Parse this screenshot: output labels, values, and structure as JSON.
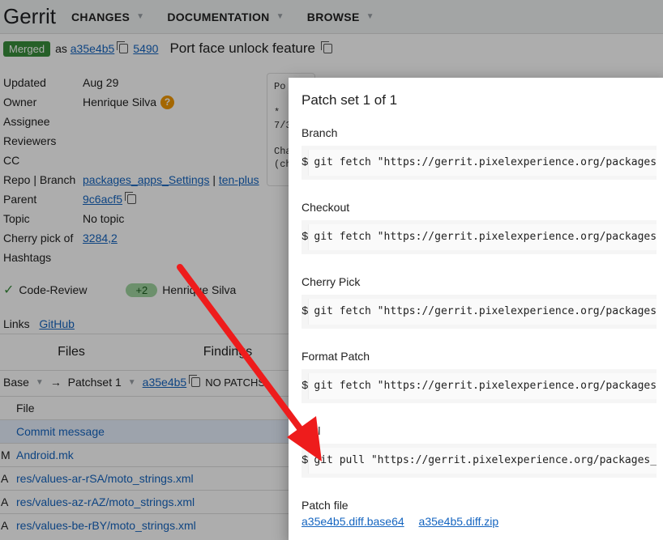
{
  "topbar": {
    "logo": "Gerrit",
    "nav": [
      "CHANGES",
      "DOCUMENTATION",
      "BROWSE"
    ]
  },
  "change": {
    "status": "Merged",
    "as_text": "as",
    "commit": "a35e4b5",
    "number": "5490",
    "subject": "Port face unlock feature"
  },
  "meta": {
    "updated_key": "Updated",
    "updated_val": "Aug 29",
    "owner_key": "Owner",
    "owner_val": "Henrique Silva",
    "assignee_key": "Assignee",
    "reviewers_key": "Reviewers",
    "cc_key": "CC",
    "repo_key": "Repo | Branch",
    "repo_val": "packages_apps_Settings",
    "repo_sep": "|",
    "branch_val": "ten-plus",
    "parent_key": "Parent",
    "parent_val": "9c6acf5",
    "topic_key": "Topic",
    "topic_val": "No topic",
    "cherry_key": "Cherry pick of",
    "cherry_val": "3284,2",
    "hashtags_key": "Hashtags"
  },
  "commit_box": {
    "line1": "Po",
    "line2": "* ",
    "line3": "7/3",
    "line4": "Cha",
    "line5": "(ch"
  },
  "votes": {
    "label": "Code-Review",
    "score": "+2",
    "voter": "Henrique Silva"
  },
  "links": {
    "label": "Links",
    "github": "GitHub"
  },
  "files": {
    "tab_files": "Files",
    "tab_findings": "Findings",
    "base": "Base",
    "arrow": "→",
    "patchset": "Patchset 1",
    "commit": "a35e4b5",
    "no_patchsets": "NO PATCHS",
    "header": "File",
    "rows": [
      {
        "status": "",
        "name": "Commit message"
      },
      {
        "status": "M",
        "name": "Android.mk"
      },
      {
        "status": "A",
        "name": "res/values-ar-rSA/moto_strings.xml"
      },
      {
        "status": "A",
        "name": "res/values-az-rAZ/moto_strings.xml"
      },
      {
        "status": "A",
        "name": "res/values-be-rBY/moto_strings.xml"
      }
    ]
  },
  "dialog": {
    "title": "Patch set 1 of 1",
    "prompt": "$",
    "commands": [
      {
        "label": "Branch",
        "cmd": "git fetch \"https://gerrit.pixelexperience.org/packages_"
      },
      {
        "label": "Checkout",
        "cmd": "git fetch \"https://gerrit.pixelexperience.org/packages_"
      },
      {
        "label": "Cherry Pick",
        "cmd": "git fetch \"https://gerrit.pixelexperience.org/packages_"
      },
      {
        "label": "Format Patch",
        "cmd": "git fetch \"https://gerrit.pixelexperience.org/packages_"
      },
      {
        "label": "Pull",
        "cmd": "git pull \"https://gerrit.pixelexperience.org/packages_a"
      }
    ],
    "patch_file_label": "Patch file",
    "patch_links": [
      "a35e4b5.diff.base64",
      "a35e4b5.diff.zip"
    ]
  },
  "colors": {
    "merged": "#388e3c",
    "link": "#1565c0",
    "arrow": "#ee1c1c"
  }
}
